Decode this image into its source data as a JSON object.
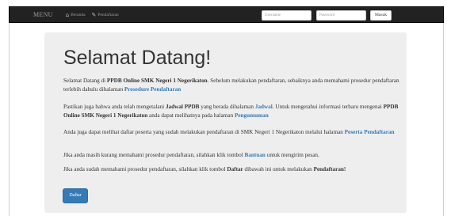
{
  "navbar": {
    "brand": "MENU",
    "links": [
      {
        "label": "Beranda",
        "icon": "home-icon"
      },
      {
        "label": "Pendaftaran",
        "icon": "pencil-icon"
      }
    ],
    "username_placeholder": "Username",
    "password_placeholder": "Password",
    "login_label": "Masuk"
  },
  "hero": {
    "title": "Selamat Datang!"
  },
  "paragraphs": {
    "p1": {
      "t1": "Selamat Datang di ",
      "b1": "PPDB Online SMK Negeri 1 Negerikaton",
      "t2": ". Sebelum melakukan pendaftaran, sebaiknya anda memahami prosedur pendaftaran terlebih dahulu dihalaman ",
      "link": "Prosedure Pendaftaran"
    },
    "p2": {
      "t1": "Pastikan juga bahwa anda telah mengetalani ",
      "b1": "Jadwal PPDB",
      "t2": " yang berada dihalaman ",
      "link1": "Jadwal",
      "t3": ". Untuk mengetahui informasi terbaru mengenai ",
      "b2": "PPDB Online SMK Negeri 1 Negerikaton",
      "t4": " anda dapat melihatnya pada halaman ",
      "link2": "Pengumuman"
    },
    "p3": {
      "t1": "Anda juga dapat melihat daftar peserta yang sudah melakukan pendaftaran di SMK Negeri 1 Negerikaton melalui halaman ",
      "link": "Peserta Pendaftaran"
    },
    "p4": {
      "t1": "Jika anda masih kurang memahami prosedur pendaftaran, silahkan klik tombol ",
      "link": "Bantuan",
      "t2": " untuk mengirim pesan."
    },
    "p5": {
      "t1": "Jika anda sudah memahami prosedur pendaftaran, silahkan klik tombol ",
      "b1": "Daftar",
      "t2": " dibawah ini untuk melakukan ",
      "b2": "Pendaftaran!"
    }
  },
  "daftar_button": "Daftar",
  "colors": {
    "navbar_bg": "#222222",
    "jumbotron_bg": "#eeeeee",
    "link": "#337ab7",
    "primary_button": "#337ab7"
  }
}
